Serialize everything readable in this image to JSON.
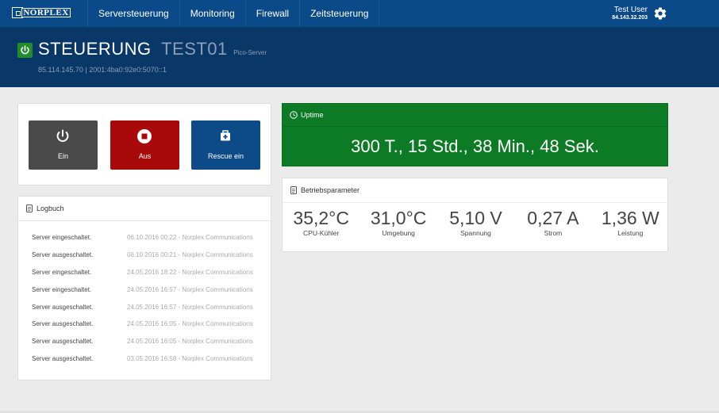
{
  "nav": {
    "logo_text": "NORPLEX",
    "items": [
      {
        "label": "Serversteuerung"
      },
      {
        "label": "Monitoring"
      },
      {
        "label": "Firewall"
      },
      {
        "label": "Zeitsteuerung"
      }
    ]
  },
  "user": {
    "name": "Test User",
    "ip": "84.143.32.203",
    "settings_icon": "gear-icon"
  },
  "header": {
    "title": "STEUERUNG",
    "server_name": "TEST01",
    "server_type": "Pico-Server",
    "addresses": "85.114.145.70 | 2001:4ba0:92e0:5070::1",
    "status_icon": "power-icon"
  },
  "actions": [
    {
      "label": "Ein",
      "icon": "power-icon",
      "color": "#4a4a4a"
    },
    {
      "label": "Aus",
      "icon": "stop-icon",
      "color": "#a80a0a"
    },
    {
      "label": "Rescue ein",
      "icon": "medkit-icon",
      "color": "#0c4a88"
    }
  ],
  "uptime": {
    "title": "Uptime",
    "value": "300 T., 15 Std., 38 Min., 48 Sek.",
    "icon": "clock-icon",
    "color": "#0d7a25"
  },
  "params": {
    "title": "Betriebsparameter",
    "icon": "document-icon",
    "items": [
      {
        "value": "35,2°C",
        "label": "CPU-Kühler"
      },
      {
        "value": "31,0°C",
        "label": "Umgebung"
      },
      {
        "value": "5,10 V",
        "label": "Spannung"
      },
      {
        "value": "0,27 A",
        "label": "Strom"
      },
      {
        "value": "1,36 W",
        "label": "Leistung"
      }
    ]
  },
  "logbook": {
    "title": "Logbuch",
    "icon": "document-icon",
    "entries": [
      {
        "message": "Server eingeschaltet.",
        "meta": "06.10.2016 00:22 - Norplex Communications"
      },
      {
        "message": "Server ausgeschaltet.",
        "meta": "06.10.2016 00:21 - Norplex Communications"
      },
      {
        "message": "Server eingeschaltet.",
        "meta": "24.05.2016 18:22 - Norplex Communications"
      },
      {
        "message": "Server eingeschaltet.",
        "meta": "24.05.2016 16:57 - Norplex Communications"
      },
      {
        "message": "Server ausgeschaltet.",
        "meta": "24.05.2016 16:57 - Norplex Communications"
      },
      {
        "message": "Server ausgeschaltet.",
        "meta": "24.05.2016 16:05 - Norplex Communications"
      },
      {
        "message": "Server ausgeschaltet.",
        "meta": "24.05.2016 16:05 - Norplex Communications"
      },
      {
        "message": "Server ausgeschaltet.",
        "meta": "03.05.2016 16:58 - Norplex Communications"
      }
    ]
  }
}
